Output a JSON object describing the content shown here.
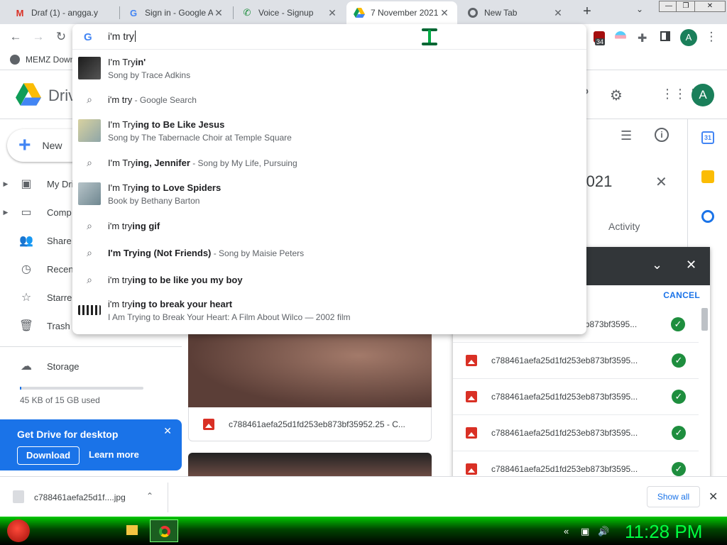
{
  "tabs": [
    {
      "label": "Draf (1) - angga.y",
      "favicon": "gmail-icon"
    },
    {
      "label": "Sign in - Google A",
      "favicon": "google-icon"
    },
    {
      "label": "Voice - Signup",
      "favicon": "voice-icon"
    },
    {
      "label": "7 November 2021",
      "favicon": "drive-icon",
      "active": true
    },
    {
      "label": "New Tab",
      "favicon": "chrome-icon"
    }
  ],
  "toolbar": {
    "omnibox_text": "i'm try",
    "extension_badge": "34",
    "profile_initial": "A"
  },
  "bookmarks": [
    {
      "label": "MEMZ Down"
    }
  ],
  "omnibox": {
    "suggestions": [
      {
        "prefix": "I'm Try",
        "bold": "in'",
        "sub": "Song by Trace Adkins",
        "kind": "entity"
      },
      {
        "prefix": "i'm try",
        "bold": "",
        "inline_sub": " - Google Search",
        "kind": "search"
      },
      {
        "prefix": "I'm Try",
        "bold": "ing to Be Like Jesus",
        "sub": "Song by The Tabernacle Choir at Temple Square",
        "kind": "entity"
      },
      {
        "prefix": "I'm Try",
        "bold": "ing, Jennifer",
        "inline_sub": " - Song by My Life, Pursuing",
        "kind": "search"
      },
      {
        "prefix": "I'm Try",
        "bold": "ing to Love Spiders",
        "sub": "Book by Bethany Barton",
        "kind": "entity"
      },
      {
        "prefix": "i'm try",
        "bold": "ing gif",
        "kind": "search"
      },
      {
        "prefix": "I'm Try",
        "bold": "ing (Not Friends)",
        "inline_sub": " - Song by Maisie Peters",
        "kind": "search"
      },
      {
        "prefix": "i'm try",
        "bold": "ing to be like you my boy",
        "kind": "search"
      },
      {
        "prefix": "i'm try",
        "bold": "ing to break your heart",
        "sub": "I Am Trying to Break Your Heart: A Film About Wilco — 2002 film",
        "kind": "entity"
      }
    ]
  },
  "drive": {
    "app_name": "Drive",
    "new_label": "New",
    "nav": [
      {
        "label": "My Dri",
        "icon": "my-drive-icon",
        "caret": true
      },
      {
        "label": "Comp",
        "icon": "computers-icon",
        "caret": true
      },
      {
        "label": "Share",
        "icon": "shared-icon"
      },
      {
        "label": "Recen",
        "icon": "recent-icon"
      },
      {
        "label": "Starre",
        "icon": "star-icon"
      },
      {
        "label": "Trash",
        "icon": "trash-icon"
      }
    ],
    "storage_label": "Storage",
    "storage_used": "45 KB of 15 GB used",
    "storage_fraction": 0.01,
    "promo": {
      "title": "Get Drive for desktop",
      "download": "Download",
      "learn_more": "Learn more"
    },
    "file_name": "c788461aefa25d1fd253eb873bf35952.25 - C...",
    "side_panel_title": "r 2021",
    "activity_tab": "Activity",
    "profile_initial": "A"
  },
  "upload": {
    "cancel_label": "CANCEL",
    "rows": [
      {
        "name": "c788461aefa25d1fd253eb873bf3595..."
      },
      {
        "name": "c788461aefa25d1fd253eb873bf3595..."
      },
      {
        "name": "c788461aefa25d1fd253eb873bf3595..."
      },
      {
        "name": "c788461aefa25d1fd253eb873bf3595..."
      },
      {
        "name": "c788461aefa25d1fd253eb873bf3595..."
      }
    ]
  },
  "download_bar": {
    "file": "c788461aefa25d1f....jpg",
    "show_all": "Show all"
  },
  "taskbar": {
    "clock": "11:28 PM"
  }
}
